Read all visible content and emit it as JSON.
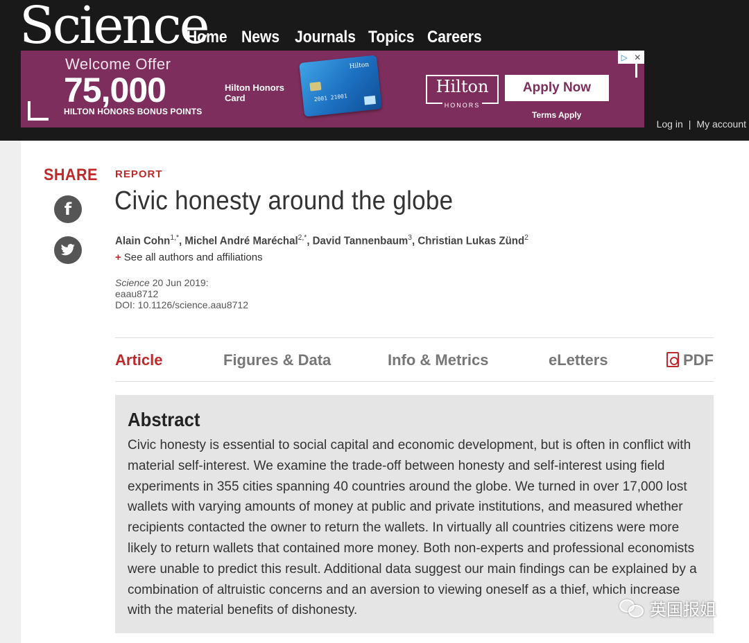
{
  "header": {
    "logo": "Science",
    "nav": [
      "Home",
      "News",
      "Journals",
      "Topics",
      "Careers"
    ],
    "account": {
      "login": "Log in",
      "separator": "|",
      "my_account": "My account"
    }
  },
  "ad": {
    "welcome": "Welcome Offer",
    "amount": "75,000",
    "bonus": "HILTON HONORS BONUS POINTS",
    "card_name": "Hilton Honors Card",
    "card_brand": "Hilton",
    "card_number": "2001 21001",
    "hilton_logo_top": "Hilton",
    "hilton_logo_bottom": "HONORS",
    "apply_label": "Apply Now",
    "terms": "Terms Apply",
    "badge_play": "▷",
    "badge_close": "✕"
  },
  "article": {
    "share_label": "SHARE",
    "type": "REPORT",
    "title": "Civic honesty around the globe",
    "authors": [
      {
        "name": "Alain Cohn",
        "sup": "1,*"
      },
      {
        "name": "Michel André Maréchal",
        "sup": "2,*"
      },
      {
        "name": "David Tannenbaum",
        "sup": "3"
      },
      {
        "name": "Christian Lukas Zünd",
        "sup": "2"
      }
    ],
    "see_all_plus": "+",
    "see_all": "See all authors and affiliations",
    "journal": "Science",
    "date": " 20 Jun 2019:",
    "article_id": "eaau8712",
    "doi": "DOI: 10.1126/science.aau8712"
  },
  "tabs": {
    "article": "Article",
    "figures": "Figures & Data",
    "info": "Info & Metrics",
    "eletters": "eLetters",
    "pdf": "PDF"
  },
  "abstract": {
    "heading": "Abstract",
    "text": "Civic honesty is essential to social capital and economic development, but is often in conflict with material self-interest. We examine the trade-off between honesty and self-interest using field experiments in 355 cities spanning 40 countries around the globe. We turned in over 17,000 lost wallets with varying amounts of money at public and private institutions, and measured whether recipients contacted the owner to return the wallets. In virtually all countries citizens were more likely to return wallets that contained more money. Both non-experts and professional economists were unable to predict this result. Additional data suggest our main findings can be explained by a combination of altruistic concerns and an aversion to viewing oneself as a thief, which increase with the material benefits of dishonesty."
  },
  "watermark": {
    "text": "英国报姐"
  },
  "colors": {
    "accent": "#bd2a2a",
    "ad_bg": "#7e2e5c",
    "header_bg": "#191919"
  }
}
